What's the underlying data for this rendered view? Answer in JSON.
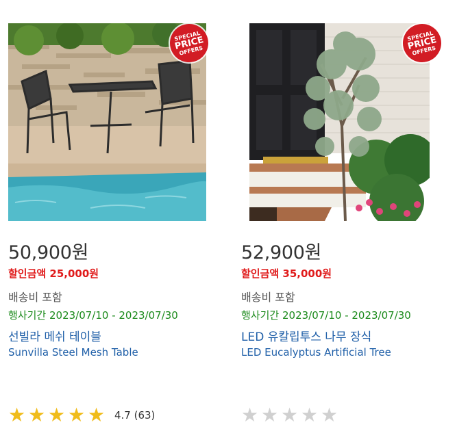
{
  "colors": {
    "badge": "#d21c24",
    "discount": "#e01b1b",
    "period": "#1b8a1b",
    "link": "#1f5fa8",
    "star_filled": "#f0bc1b",
    "star_empty": "#d0d0d0"
  },
  "products": [
    {
      "badge": {
        "line1": "SPECIAL",
        "line2": "PRICE",
        "line3": "OFFERS"
      },
      "price": "50,900원",
      "discount": "할인금액 25,000원",
      "shipping": "배송비 포함",
      "period_label": "행사기간",
      "period_value": "2023/07/10 - 2023/07/30",
      "name_ko": "선빌라 메쉬 테이블",
      "name_en": "Sunvilla Steel Mesh Table",
      "rating": {
        "stars": 5,
        "filled": 5,
        "text": "4.7 (63)"
      }
    },
    {
      "badge": {
        "line1": "SPECIAL",
        "line2": "PRICE",
        "line3": "OFFERS"
      },
      "price": "52,900원",
      "discount": "할인금액 35,000원",
      "shipping": "배송비 포함",
      "period_label": "행사기간",
      "period_value": "2023/07/10 - 2023/07/30",
      "name_ko": "LED 유칼립투스 나무 장식",
      "name_en": "LED Eucalyptus Artificial Tree",
      "rating": {
        "stars": 5,
        "filled": 0,
        "text": ""
      }
    }
  ]
}
